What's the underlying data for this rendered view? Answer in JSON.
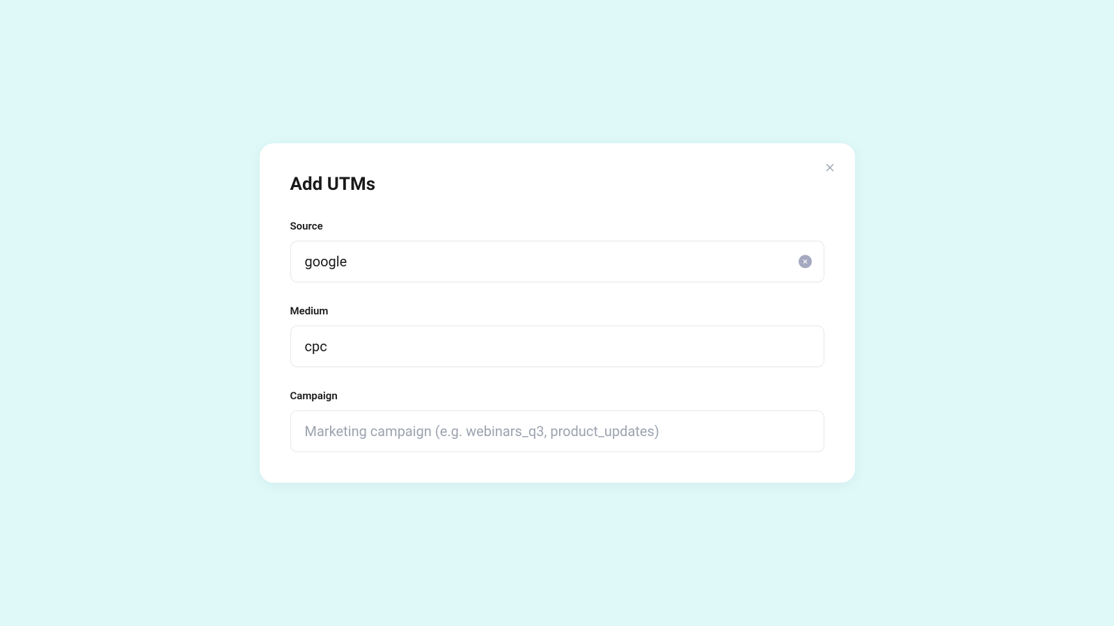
{
  "modal": {
    "title": "Add UTMs",
    "fields": {
      "source": {
        "label": "Source",
        "value": "google",
        "placeholder": ""
      },
      "medium": {
        "label": "Medium",
        "value": "cpc",
        "placeholder": ""
      },
      "campaign": {
        "label": "Campaign",
        "value": "",
        "placeholder": "Marketing campaign (e.g. webinars_q3, product_updates)"
      }
    }
  }
}
